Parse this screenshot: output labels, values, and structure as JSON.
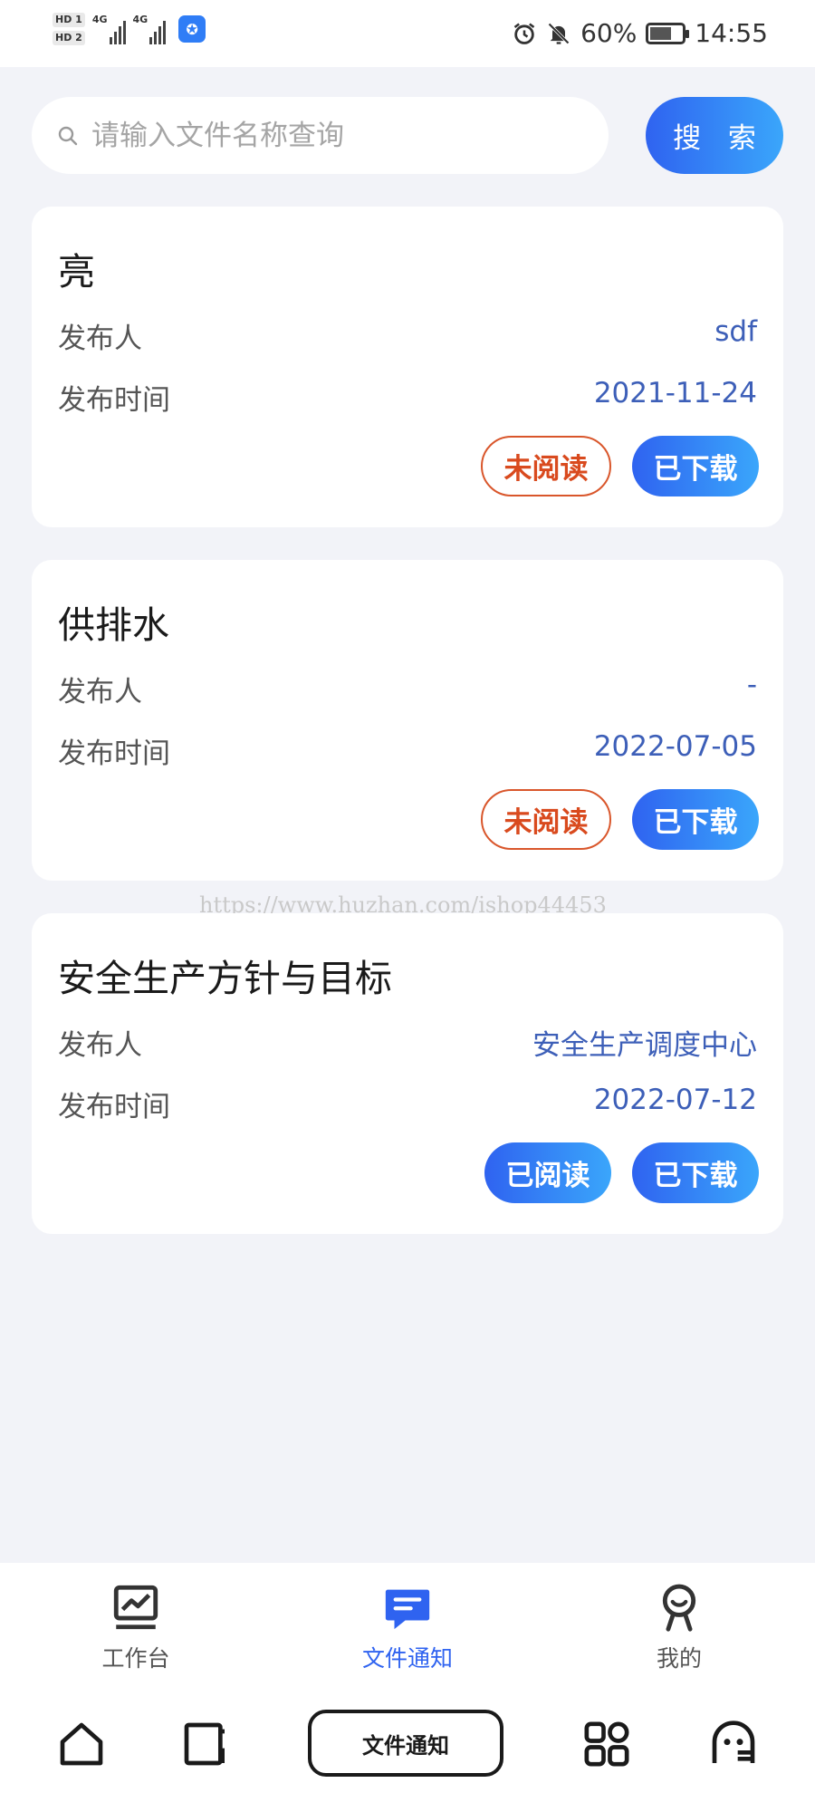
{
  "status_bar": {
    "hd1": "HD 1",
    "hd2": "HD 2",
    "net1": "4G",
    "net2": "4G",
    "battery": "60%",
    "time": "14:55"
  },
  "search": {
    "placeholder": "请输入文件名称查询",
    "value": "",
    "button_label": "搜 索"
  },
  "labels": {
    "publisher": "发布人",
    "publish_time": "发布时间"
  },
  "documents": [
    {
      "title": "亮",
      "publisher": "sdf",
      "date": "2021-11-24",
      "read_label": "未阅读",
      "read": false,
      "download_label": "已下载"
    },
    {
      "title": "供排水",
      "publisher": "-",
      "date": "2022-07-05",
      "read_label": "未阅读",
      "read": false,
      "download_label": "已下载"
    },
    {
      "title": "安全生产方针与目标",
      "publisher": "安全生产调度中心",
      "date": "2022-07-12",
      "read_label": "已阅读",
      "read": true,
      "download_label": "已下载"
    }
  ],
  "watermark": "https://www.huzhan.com/ishop44453",
  "tabbar": {
    "items": [
      {
        "label": "工作台",
        "icon": "chart-icon"
      },
      {
        "label": "文件通知",
        "icon": "message-icon",
        "active": true
      },
      {
        "label": "我的",
        "icon": "profile-icon"
      }
    ]
  },
  "navbar": {
    "current_app": "文件通知"
  },
  "colors": {
    "accent": "#2f63f0",
    "accent_light": "#3aa6fb",
    "unread": "#d94a1e",
    "value_text": "#3d5fb8",
    "background": "#f2f3f8"
  }
}
